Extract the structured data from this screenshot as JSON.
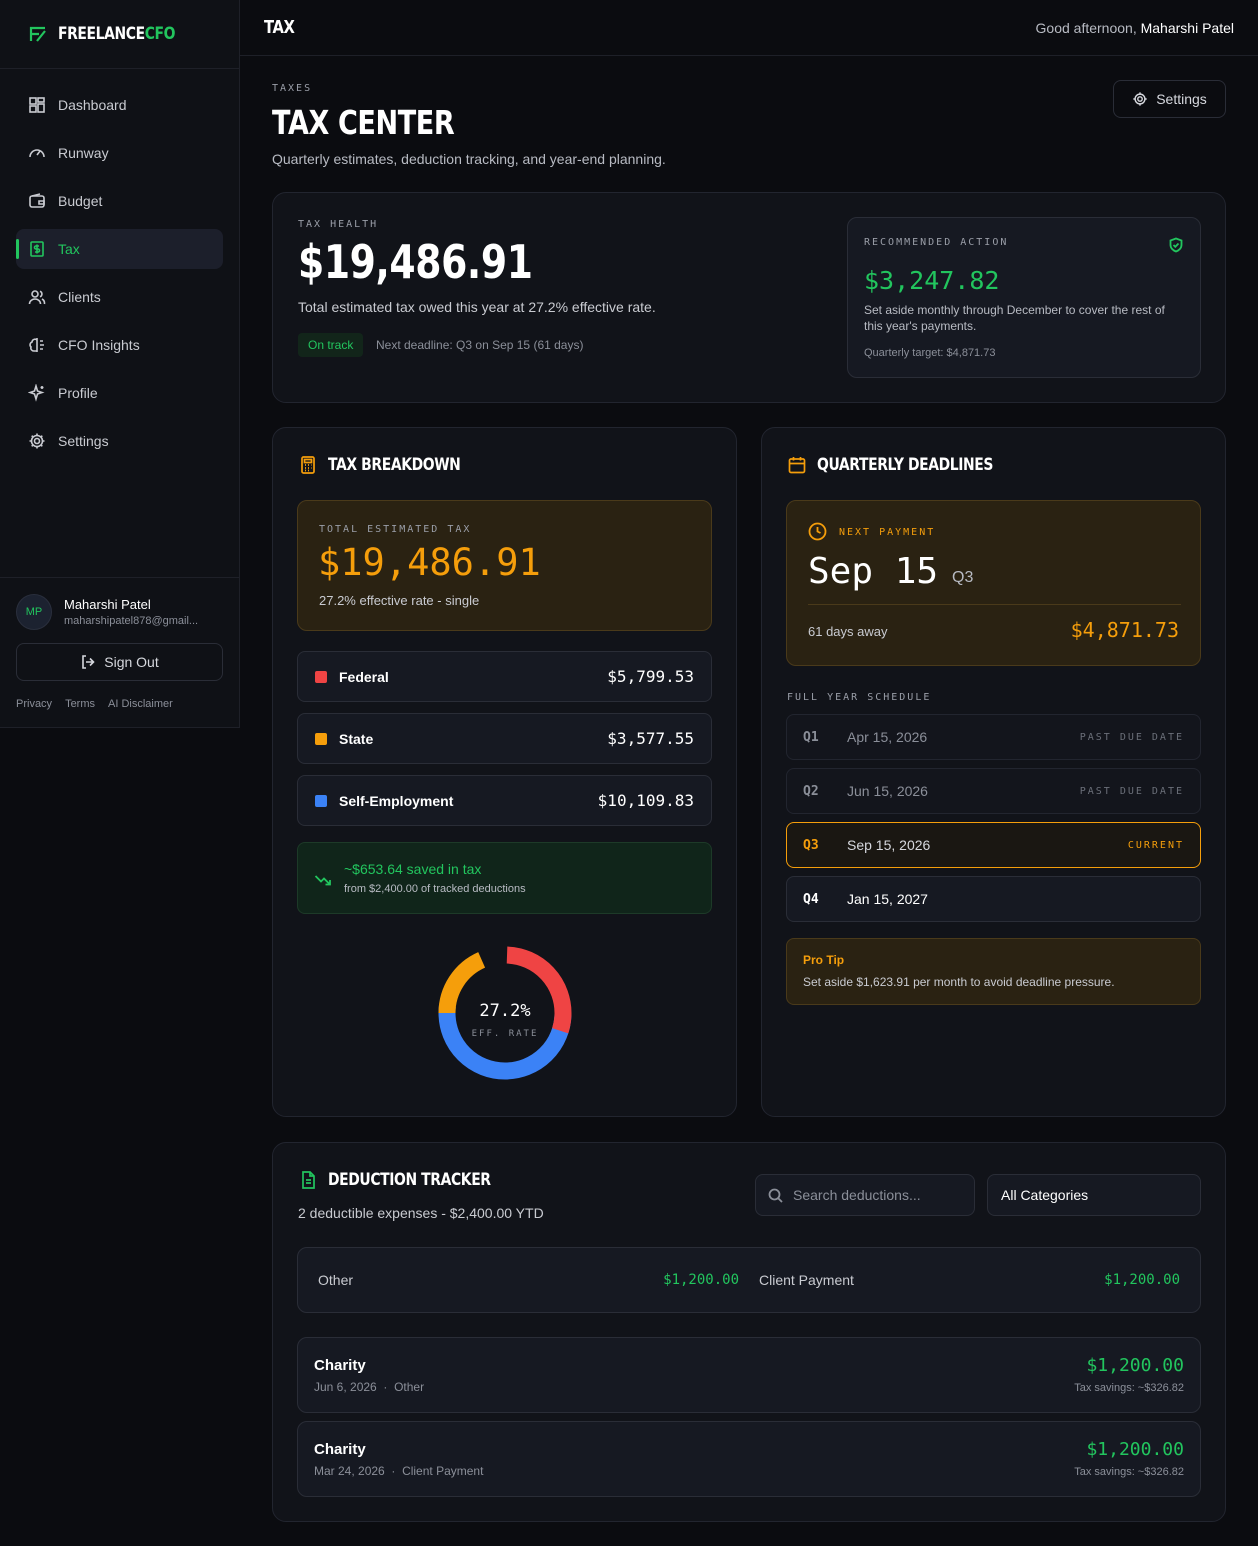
{
  "brand": {
    "name": "FREELANCE",
    "accent": "CFO"
  },
  "sidebar": {
    "items": [
      {
        "label": "Dashboard",
        "icon": "dashboard-icon"
      },
      {
        "label": "Runway",
        "icon": "gauge-icon"
      },
      {
        "label": "Budget",
        "icon": "wallet-icon"
      },
      {
        "label": "Tax",
        "icon": "dollar-receipt-icon",
        "active": true
      },
      {
        "label": "Clients",
        "icon": "users-icon"
      },
      {
        "label": "CFO Insights",
        "icon": "brain-icon"
      },
      {
        "label": "Profile",
        "icon": "sparkles-icon"
      },
      {
        "label": "Settings",
        "icon": "gear-icon"
      }
    ],
    "user": {
      "initials": "MP",
      "name": "Maharshi Patel",
      "email": "maharshipatel878@gmail..."
    },
    "sign_out": "Sign Out",
    "legal": [
      "Privacy",
      "Terms",
      "AI Disclaimer"
    ]
  },
  "topbar": {
    "title": "TAX",
    "greeting": "Good afternoon,",
    "user": "Maharshi Patel"
  },
  "page": {
    "eyebrow": "TAXES",
    "title": "TAX CENTER",
    "subtitle": "Quarterly estimates, deduction tracking, and year-end planning.",
    "settings_label": "Settings"
  },
  "health": {
    "eyebrow": "TAX HEALTH",
    "amount": "$19,486.91",
    "description": "Total estimated tax owed this year at 27.2% effective rate.",
    "status": "On track",
    "next_deadline": "Next deadline: Q3 on Sep 15 (61 days)",
    "recommended": {
      "eyebrow": "RECOMMENDED ACTION",
      "amount": "$3,247.82",
      "description": "Set aside monthly through December to cover the rest of this year's payments.",
      "target": "Quarterly target: $4,871.73"
    }
  },
  "breakdown": {
    "title": "TAX BREAKDOWN",
    "total_eyebrow": "TOTAL ESTIMATED TAX",
    "total_amount": "$19,486.91",
    "total_sub": "27.2% effective rate - single",
    "rows": [
      {
        "label": "Federal",
        "value": "$5,799.53",
        "color": "#ef4444"
      },
      {
        "label": "State",
        "value": "$3,577.55",
        "color": "#f59e0b"
      },
      {
        "label": "Self-Employment",
        "value": "$10,109.83",
        "color": "#3b82f6"
      }
    ],
    "savings_title": "~$653.64 saved in tax",
    "savings_sub": "from $2,400.00 of tracked deductions",
    "donut": {
      "center": "27.2%",
      "label": "EFF. RATE"
    }
  },
  "deadlines": {
    "title": "QUARTERLY DEADLINES",
    "next_label": "NEXT PAYMENT",
    "next_date": "Sep 15",
    "next_quarter": "Q3",
    "days_away": "61 days away",
    "next_amount": "$4,871.73",
    "schedule_label": "FULL YEAR SCHEDULE",
    "quarters": [
      {
        "q": "Q1",
        "date": "Apr 15, 2026",
        "status": "PAST DUE DATE"
      },
      {
        "q": "Q2",
        "date": "Jun 15, 2026",
        "status": "PAST DUE DATE"
      },
      {
        "q": "Q3",
        "date": "Sep 15, 2026",
        "status": "CURRENT"
      },
      {
        "q": "Q4",
        "date": "Jan 15, 2027",
        "status": ""
      }
    ],
    "protip_title": "Pro Tip",
    "protip_text": "Set aside $1,623.91 per month to avoid deadline pressure."
  },
  "deductions": {
    "title": "DEDUCTION TRACKER",
    "subtitle": "2 deductible expenses - $2,400.00 YTD",
    "search_placeholder": "Search deductions...",
    "category": "All Categories",
    "summary": [
      {
        "label": "Other",
        "value": "$1,200.00"
      },
      {
        "label": "Client Payment",
        "value": "$1,200.00"
      }
    ],
    "items": [
      {
        "name": "Charity",
        "date": "Jun 6, 2026",
        "category": "Other",
        "amount": "$1,200.00",
        "savings": "Tax savings: ~$326.82"
      },
      {
        "name": "Charity",
        "date": "Mar 24, 2026",
        "category": "Client Payment",
        "amount": "$1,200.00",
        "savings": "Tax savings: ~$326.82"
      }
    ]
  }
}
